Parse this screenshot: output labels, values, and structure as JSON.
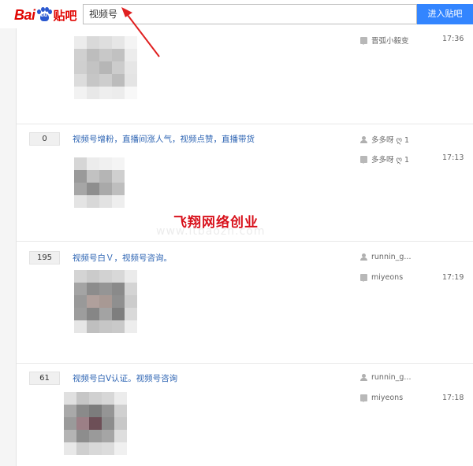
{
  "header": {
    "logo_bai": "Bai",
    "logo_tieba": "贴吧",
    "search_value": "视频号",
    "search_button": "进入贴吧"
  },
  "watermark": {
    "text": "飞翔网络创业",
    "url": "www.itbaozn.com"
  },
  "threads": [
    {
      "reply_count": "",
      "title": "",
      "author": "",
      "last_replier": "晋弧小毅变",
      "time": "17:36"
    },
    {
      "reply_count": "0",
      "title": "视频号增粉，直播间涨人气，视频点赞，直播带货",
      "author": "多多呀 ღ 1",
      "last_replier": "多多呀 ღ 1",
      "time": "17:13"
    },
    {
      "reply_count": "195",
      "title": "视频号白Ｖ，视频号咨询。",
      "author": "runnin_g...",
      "last_replier": "miyeons",
      "time": "17:19"
    },
    {
      "reply_count": "61",
      "title": "视频号白V认证。视频号咨询",
      "author": "runnin_g...",
      "last_replier": "miyeons",
      "time": "17:18"
    }
  ],
  "icons": {
    "author": "user-icon",
    "last_reply": "reply-bubble-icon"
  },
  "colors": {
    "brand_red": "#e10602",
    "brand_blue": "#2a58cf",
    "button_blue": "#3385ff",
    "link_blue": "#2d64b3",
    "annotation_arrow": "#e02020"
  }
}
